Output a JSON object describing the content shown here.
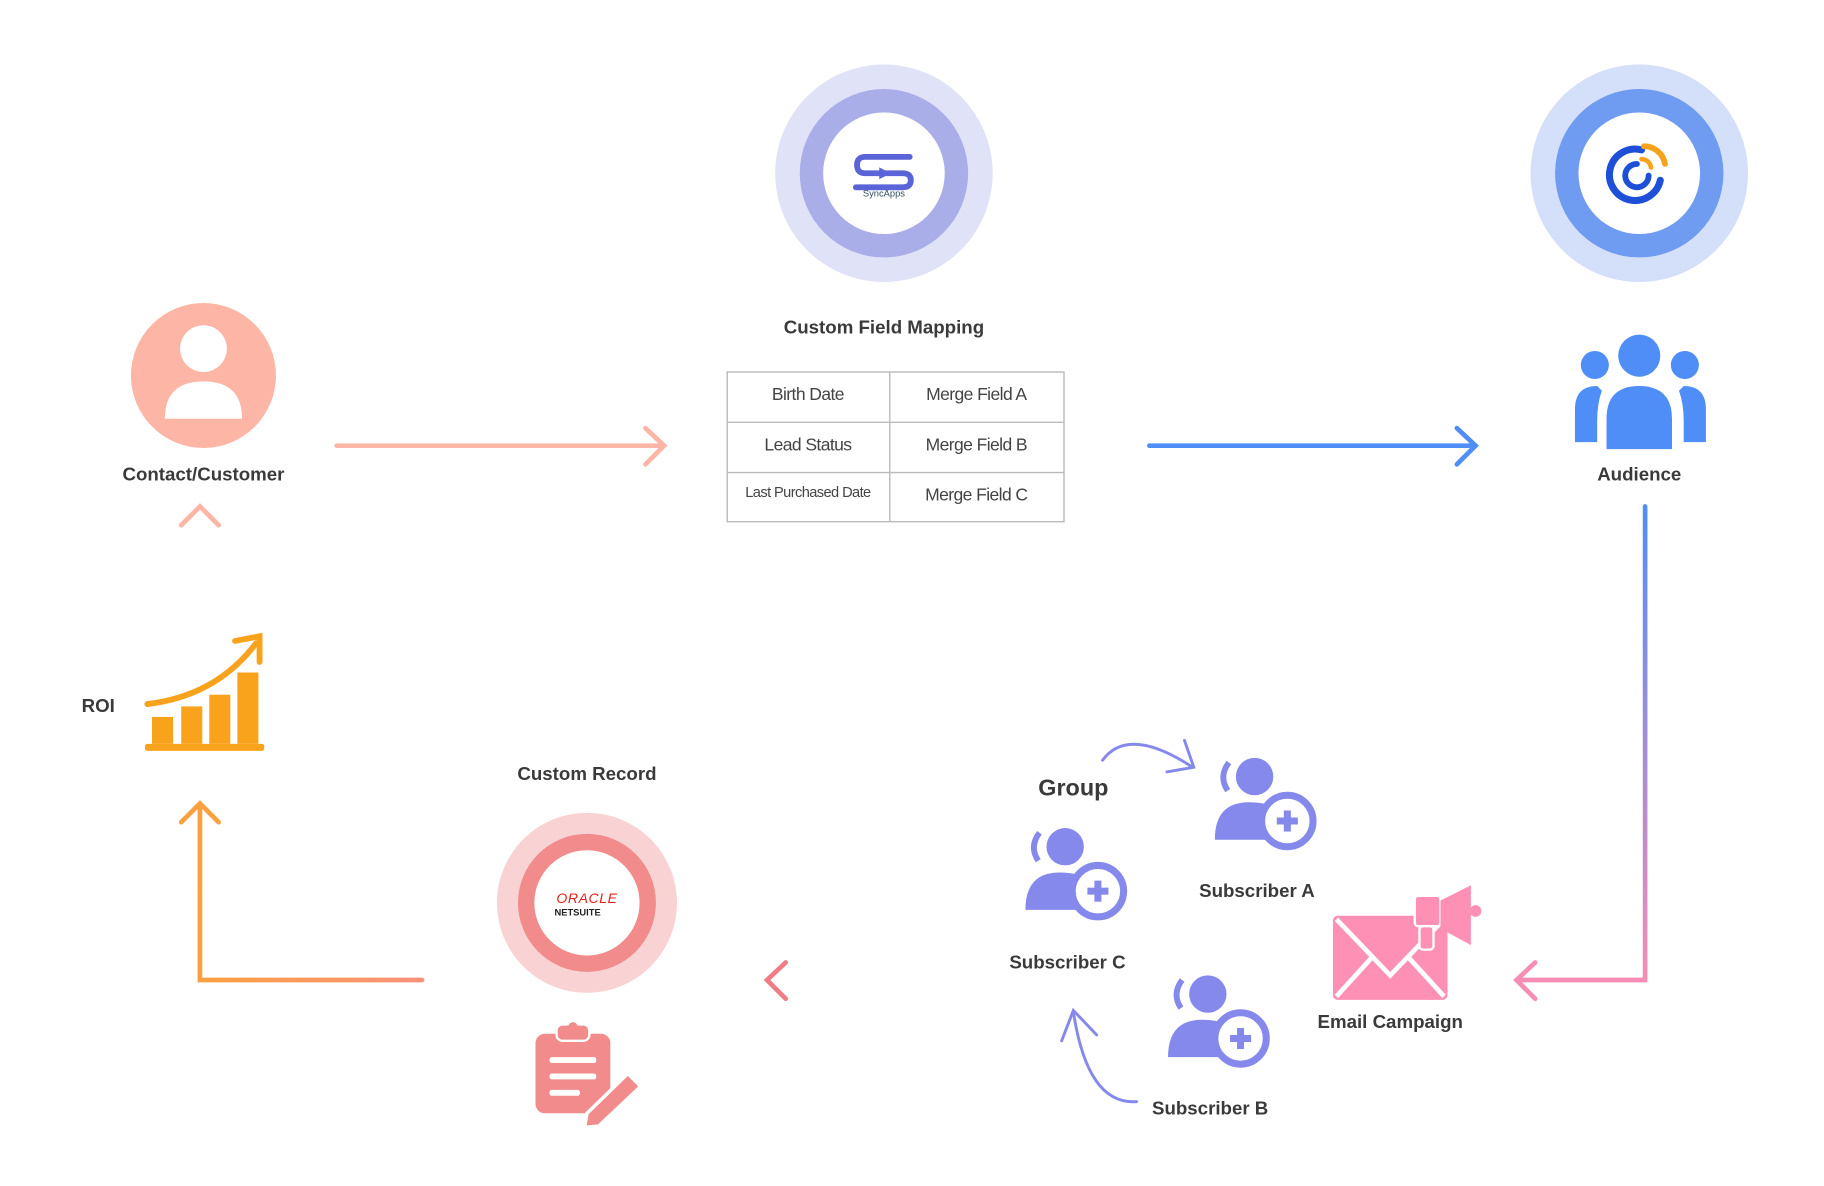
{
  "nodes": {
    "contact": "Contact/Customer",
    "mapping_title": "Custom Field Mapping",
    "audience": "Audience",
    "email_campaign": "Email Campaign",
    "group": "Group",
    "subscriber_a": "Subscriber A",
    "subscriber_b": "Subscriber B",
    "subscriber_c": "Subscriber C",
    "custom_record": "Custom Record",
    "roi": "ROI"
  },
  "logos": {
    "syncapps": "SyncApps",
    "oracle": "ORACLE",
    "netsuite": "NETSUITE"
  },
  "mapping_table": [
    [
      "Birth Date",
      "Merge Field A"
    ],
    [
      "Lead Status",
      "Merge Field B"
    ],
    [
      "Last Purchased Date",
      "Merge Field C"
    ]
  ],
  "colors": {
    "contact": "#FDB5A5",
    "syncapps": "#5A63D8",
    "audience": "#4F8EF7",
    "email": "#FF90B5",
    "subscriber": "#8489EB",
    "netsuite": "#F28B8B",
    "roi": "#F9A21B"
  },
  "icons": {
    "contact": "user-circle-icon",
    "audience": "users-group-icon",
    "email": "envelope-megaphone-icon",
    "subscriber": "user-add-icon",
    "record": "clipboard-edit-icon",
    "roi": "growth-chart-icon"
  }
}
